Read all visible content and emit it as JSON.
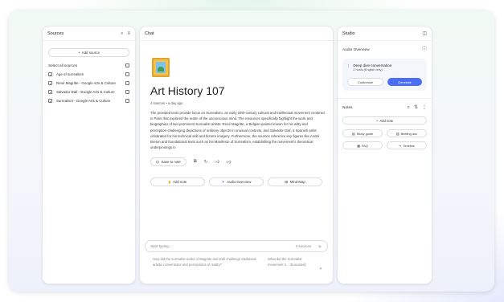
{
  "sources": {
    "title": "Sources",
    "add_label": "Add source",
    "select_all_label": "Select all sources",
    "items": [
      {
        "name": "Age of surrealism"
      },
      {
        "name": "René Magritte - Google Arts & Culture"
      },
      {
        "name": "Salvador Dalí - Google Arts & Culture"
      },
      {
        "name": "Surrealism - Google Arts & Culture"
      }
    ]
  },
  "chat": {
    "title": "Chat",
    "notebook_title": "Art History 107",
    "meta": "4 sources • a day ago",
    "summary": "The provided texts provide focus on Surrealism, an early 20th-century cultural and intellectual movement centered in Paris that explored the realm of the unconscious mind. The resources specifically highlight the work and biographies of two prominent Surrealist artists: René Magritte, a Belgian painter known for his witty and perception-challenging depictions of ordinary objects in unusual contexts, and Salvador Dalí, a Spanish artist celebrated for his technical skill and bizarre imagery. Furthermore, the sources reference key figures like André Breton and foundational texts such as his Manifesto of Surrealism, establishing the movement's theoretical underpinnings in",
    "save_note_label": "Save to note",
    "suggestions": [
      {
        "label": "Add note",
        "icon": "note-add-icon"
      },
      {
        "label": "Audio Overview",
        "icon": "sparkle-icon"
      },
      {
        "label": "Mind Map",
        "icon": "mind-map-icon"
      }
    ],
    "input_placeholder": "Start typing...",
    "source_count": "4 sources",
    "suggested_q1": "How did the surrealist works of Magritte and Dalí challenge traditional artistic conventions and perceptions of reality?",
    "suggested_q2": "What did the Surrealist movement s... (truncated)"
  },
  "studio": {
    "title": "Studio",
    "audio_overview_label": "Audio Overview",
    "deep_dive_title": "Deep dive conversation",
    "deep_dive_sub": "2 hosts (English only)",
    "customize_label": "Customize",
    "generate_label": "Generate",
    "notes_label": "Notes",
    "add_note_label": "Add note",
    "note_buttons": [
      {
        "label": "Study guide",
        "icon": "study-guide-icon"
      },
      {
        "label": "Briefing doc",
        "icon": "briefing-doc-icon"
      },
      {
        "label": "FAQ",
        "icon": "faq-icon"
      },
      {
        "label": "Timeline",
        "icon": "timeline-icon"
      }
    ]
  },
  "colors": {
    "accent": "#4c6ef5",
    "frame_green": "#e3f5e9",
    "frame_blue": "#e3e8fb"
  }
}
